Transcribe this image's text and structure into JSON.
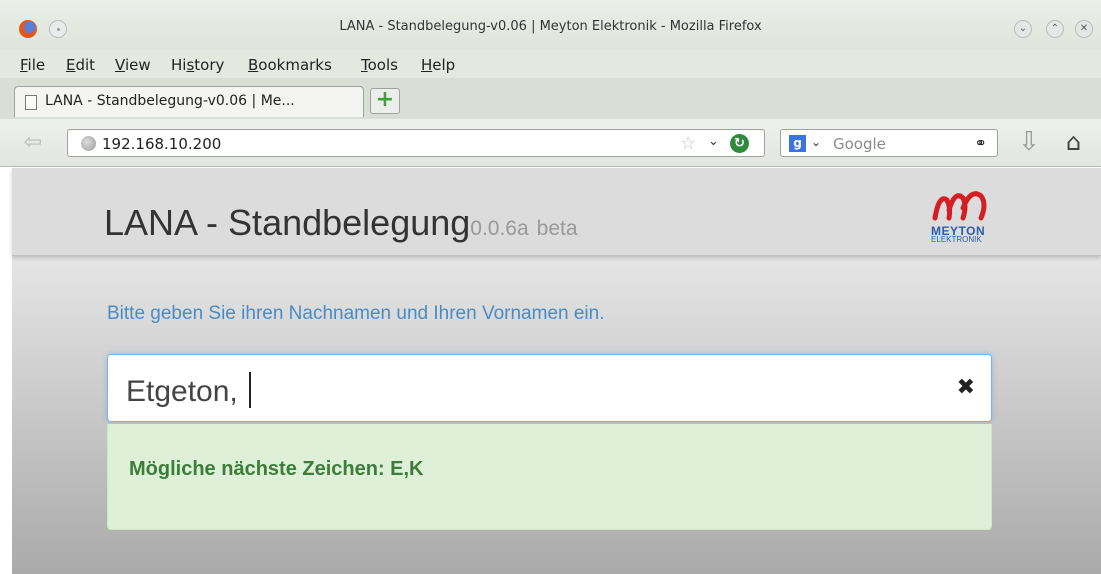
{
  "window": {
    "title": "LANA - Standbelegung-v0.06 | Meyton Elektronik - Mozilla Firefox"
  },
  "menu": [
    {
      "label": "File",
      "accel": "F",
      "rest": "ile"
    },
    {
      "label": "Edit",
      "accel": "E",
      "rest": "dit"
    },
    {
      "label": "View",
      "accel": "V",
      "rest": "iew"
    },
    {
      "label": "History",
      "accel": "s",
      "pre": "Hi",
      "rest": "tory"
    },
    {
      "label": "Bookmarks",
      "accel": "B",
      "rest": "ookmarks"
    },
    {
      "label": "Tools",
      "accel": "T",
      "rest": "ools"
    },
    {
      "label": "Help",
      "accel": "H",
      "rest": "elp"
    }
  ],
  "tab": {
    "label": "LANA - Standbelegung-v0.06 | Me..."
  },
  "newtab_symbol": "+",
  "navbar": {
    "url": "192.168.10.200",
    "search_engine": "g-icon",
    "search_placeholder": "Google"
  },
  "page": {
    "brand": "LANA - Standbelegung",
    "version": "0.0.6a",
    "beta": "beta",
    "logo_name": "MEYTON",
    "logo_sub": "ELEKTRONIK",
    "prompt": "Bitte geben Sie ihren Nachnamen und Ihren Vornamen ein.",
    "input_value": "Etgeton, ",
    "clear_symbol": "✖",
    "hint": "Mögliche nächste Zeichen: E,K"
  }
}
